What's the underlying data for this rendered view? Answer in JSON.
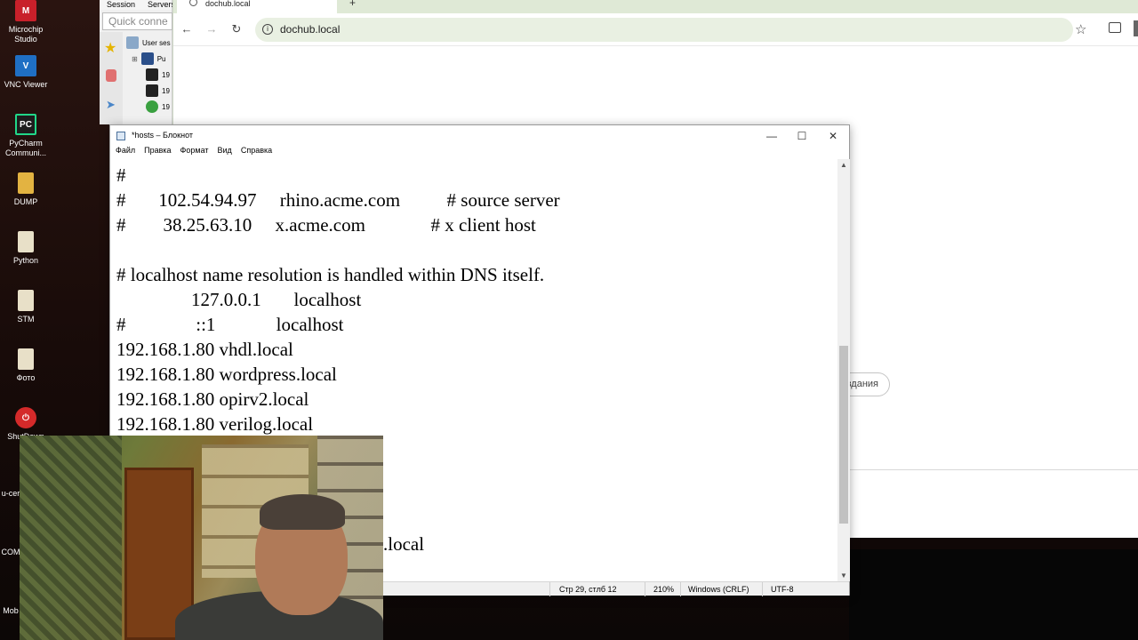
{
  "desktop": {
    "icons": [
      {
        "label": "Microchip Studio",
        "icon": "microchip-studio-icon",
        "color": "#c8202a",
        "glyph": "M"
      },
      {
        "label": "VNC Viewer",
        "icon": "vnc-viewer-icon",
        "color": "#1f6fc4",
        "glyph": "V"
      },
      {
        "label": "PyCharm Communi...",
        "icon": "pycharm-icon",
        "color": "#1d1d1d",
        "glyph": "PC"
      },
      {
        "label": "DUMP",
        "icon": "folder-icon",
        "color": "#e3b341",
        "glyph": ""
      },
      {
        "label": "Python",
        "icon": "python-file-icon",
        "color": "#e8e0c8",
        "glyph": ""
      },
      {
        "label": "STM",
        "icon": "stm-file-icon",
        "color": "#e8e0c8",
        "glyph": ""
      },
      {
        "label": "Фото",
        "icon": "photo-file-icon",
        "color": "#e8e0c8",
        "glyph": ""
      },
      {
        "label": "ShutDown",
        "icon": "shutdown-icon",
        "color": "#d42a2a",
        "glyph": "⏻"
      }
    ],
    "partial_labels": [
      "u-cer",
      "COM",
      "Mob"
    ]
  },
  "mobaxterm": {
    "menu": [
      "Session",
      "Servers"
    ],
    "quick_connect_placeholder": "Quick conne",
    "tree": [
      {
        "label": "User ses"
      },
      {
        "label": "Pu"
      },
      {
        "label": "19"
      },
      {
        "label": "19"
      },
      {
        "label": "19"
      }
    ]
  },
  "browser": {
    "tab_title": "dochub.local",
    "new_tab": "+",
    "url": "dochub.local",
    "pill_label": "здания"
  },
  "notepad": {
    "title": "*hosts – Блокнот",
    "menu": [
      "Файл",
      "Правка",
      "Формат",
      "Вид",
      "Справка"
    ],
    "lines": [
      "#",
      "#       102.54.94.97     rhino.acme.com          # source server",
      "#        38.25.63.10     x.acme.com              # x client host",
      "",
      "# localhost name resolution is handled within DNS itself.",
      "                127.0.0.1       localhost",
      "#               ::1             localhost",
      "192.168.1.80 vhdl.local",
      "192.168.1.80 wordpress.local",
      "192.168.1.80 opirv2.local",
      "192.168.1.80 verilog.local"
    ],
    "hidden_line_fragment": ".local",
    "status": {
      "position": "Стр 29, стлб 12",
      "zoom": "210%",
      "line_endings": "Windows (CRLF)",
      "encoding": "UTF-8"
    },
    "window_buttons": {
      "minimize": "—",
      "maximize": "☐",
      "close": "✕"
    }
  }
}
